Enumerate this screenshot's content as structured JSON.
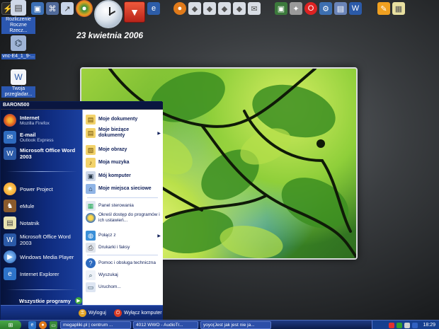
{
  "date": "23 kwietnia 2006",
  "desktop_icons": [
    {
      "label": "Rozliczenie Roczne Rzecz...",
      "icon": "tax-form-icon"
    },
    {
      "label": "vnc-E4_1_9-...",
      "icon": "installer-icon"
    },
    {
      "label": "Twoja przegladar...",
      "icon": "document-icon"
    }
  ],
  "start_menu": {
    "user": "BARON500",
    "pinned": [
      {
        "title": "Internet",
        "sub": "Mozilla Firefox"
      },
      {
        "title": "E-mail",
        "sub": "Outlook Express"
      },
      {
        "title": "Microsoft Office Word 2003",
        "sub": ""
      }
    ],
    "recent": [
      "Power Project",
      "eMule",
      "Notatnik",
      "Microsoft Office Word 2003",
      "Windows Media Player",
      "Internet Explorer"
    ],
    "all_programs": "Wszystkie programy",
    "places": [
      "Moje dokumenty",
      "Moje bieżące dokumenty",
      "Moje obrazy",
      "Moja muzyka",
      "Mój komputer",
      "Moje miejsca sieciowe"
    ],
    "settings": [
      "Panel sterowania",
      "Określ dostęp do programów i ich ustawień...",
      "Połącz z",
      "Drukarki i faksy"
    ],
    "tools": [
      "Pomoc i obsługa techniczna",
      "Wyszukaj",
      "Uruchom..."
    ],
    "logoff": "Wyloguj",
    "shutdown": "Wyłącz komputer"
  },
  "taskbar": {
    "start_label": "",
    "tasks": [
      "megapliki.pl | centrum ...",
      "4012 WWO - AudioTr...",
      "yoyo(Jest jak jest nie ja..."
    ],
    "clock": "18:29"
  }
}
